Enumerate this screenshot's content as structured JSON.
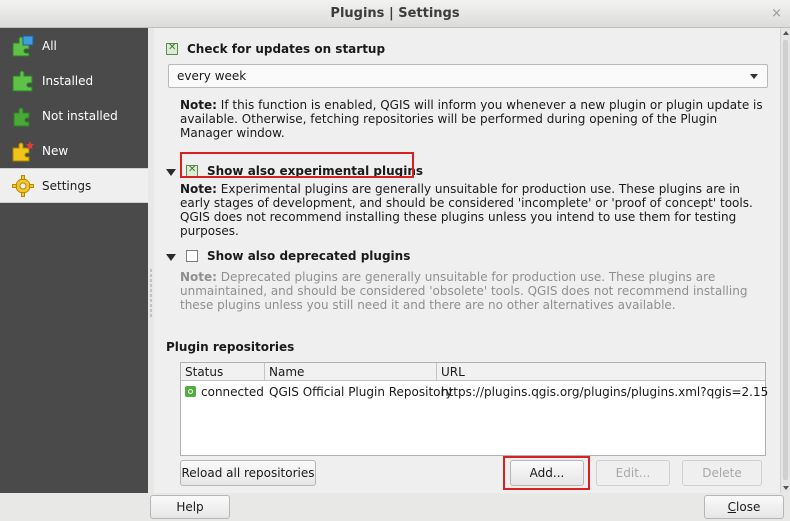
{
  "window": {
    "title": "Plugins | Settings",
    "close_glyph": "×"
  },
  "sidebar": {
    "items": [
      {
        "label": "All",
        "icon": "puzzle-all-icon"
      },
      {
        "label": "Installed",
        "icon": "puzzle-installed-icon"
      },
      {
        "label": "Not installed",
        "icon": "puzzle-not-installed-icon"
      },
      {
        "label": "New",
        "icon": "puzzle-new-icon"
      },
      {
        "label": "Settings",
        "icon": "gear-icon"
      }
    ],
    "active_index": 4
  },
  "settings": {
    "check_updates": {
      "label": "Check for updates on startup",
      "checked": true
    },
    "frequency": {
      "value": "every week"
    },
    "update_note": {
      "prefix": "Note:",
      "text": " If this function is enabled, QGIS will inform you whenever a new plugin or plugin update is available. Otherwise, fetching repositories will be performed during opening of the Plugin Manager window."
    },
    "experimental": {
      "label": "Show also experimental plugins",
      "checked": true
    },
    "experimental_note": {
      "prefix": "Note:",
      "text": " Experimental plugins are generally unsuitable for production use. These plugins are in early stages of development, and should be considered 'incomplete' or 'proof of concept' tools. QGIS does not recommend installing these plugins unless you intend to use them for testing purposes."
    },
    "deprecated": {
      "label": "Show also deprecated plugins",
      "checked": false
    },
    "deprecated_note": {
      "prefix": "Note:",
      "text": " Deprecated plugins are generally unsuitable for production use. These plugins are unmaintained, and should be considered 'obsolete' tools. QGIS does not recommend installing these plugins unless you still need it and there are no other alternatives available."
    }
  },
  "repositories": {
    "title": "Plugin repositories",
    "columns": [
      "Status",
      "Name",
      "URL"
    ],
    "rows": [
      {
        "status": "connected",
        "name": "QGIS Official Plugin Repository",
        "url": "https://plugins.qgis.org/plugins/plugins.xml?qgis=2.15"
      }
    ],
    "reload_label": "Reload all repositories",
    "add_label": "Add...",
    "edit_label": "Edit...",
    "delete_label": "Delete"
  },
  "footer": {
    "help_label": "Help",
    "close_label": "Close",
    "close_mnemonic": "C",
    "close_rest": "lose"
  },
  "colors": {
    "highlight": "#d82020",
    "sidebar_bg": "#4a4a4a",
    "status_ok": "#4fae3c"
  }
}
